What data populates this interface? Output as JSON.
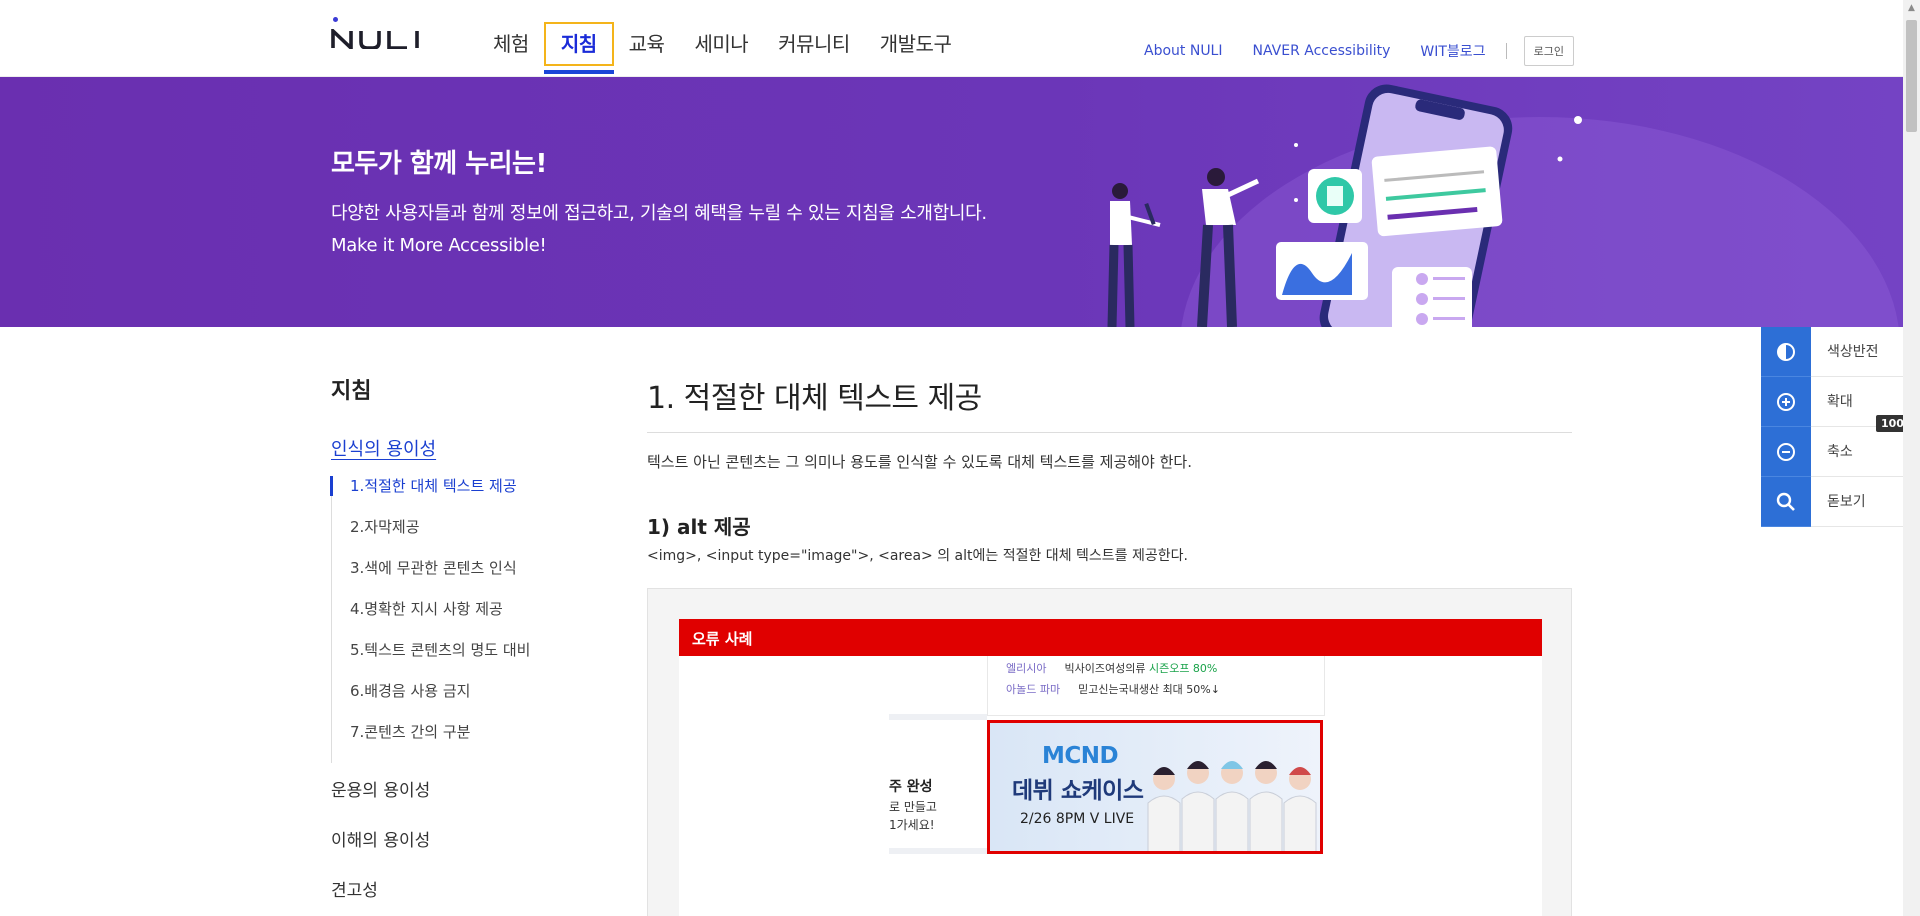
{
  "header": {
    "logo_text": "NULI",
    "nav": [
      "체험",
      "지침",
      "교육",
      "세미나",
      "커뮤니티",
      "개발도구"
    ],
    "active_nav": "지침",
    "util_links": [
      "About NULI",
      "NAVER Accessibility",
      "WIT블로그"
    ],
    "login_label": "로그인"
  },
  "hero": {
    "title": "모두가 함께 누리는!",
    "desc_line1": "다양한 사용자들과 함께 정보에 접근하고, 기술의 혜택을 누릴 수 있는 지침을 소개합니다.",
    "desc_line2": "Make it More Accessible!"
  },
  "lnb": {
    "title": "지침",
    "category1": "인식의 용이성",
    "sub_items": [
      "1.적절한 대체 텍스트 제공",
      "2.자막제공",
      "3.색에 무관한 콘텐츠 인식",
      "4.명확한 지시 사항 제공",
      "5.텍스트 콘텐츠의 명도 대비",
      "6.배경음 사용 금지",
      "7.콘텐츠 간의 구분"
    ],
    "category2": "운용의 용이성",
    "category3": "이해의 용이성",
    "category4": "견고성"
  },
  "content": {
    "title": "1. 적절한 대체 텍스트 제공",
    "intro": "텍스트 아닌 콘텐츠는 그 의미나 용도를 인식할 수 있도록 대체 텍스트를 제공해야 한다.",
    "section_title": "1) alt 제공",
    "section_desc": "<img>, <input type=\"image\">, <area> 의 alt에는 적절한 대체 텍스트를 제공한다.",
    "example": {
      "header": "오류 사례",
      "row1_brand": "엘리시아",
      "row1_text": "빅사이즈여성의류 ",
      "row1_highlight": "시즌오프 80%",
      "row2_brand": "아놀드 파마",
      "row2_text": "믿고신는국내생산 최대 50%↓",
      "left_title": "주 완성",
      "left_text_line1": "로 만들고",
      "left_text_line2": "1가세요!",
      "banner_line1": "MCND",
      "banner_line2": "데뷔 쇼케이스",
      "banner_line3": "2/26 8PM V LIVE"
    }
  },
  "tools": {
    "items": [
      {
        "label": "색상반전",
        "icon": "contrast-icon"
      },
      {
        "label": "확대",
        "icon": "zoom-in-icon"
      },
      {
        "label": "축소",
        "icon": "zoom-out-icon"
      },
      {
        "label": "돋보기",
        "icon": "magnifier-icon"
      }
    ],
    "zoom_level": "100"
  },
  "colors": {
    "brand_blue": "#1a3fd0",
    "hero_purple": "#6a2fb0",
    "focus_outline": "#f4b41a",
    "error_red": "#e00000",
    "tool_blue": "#2d6fd6"
  }
}
